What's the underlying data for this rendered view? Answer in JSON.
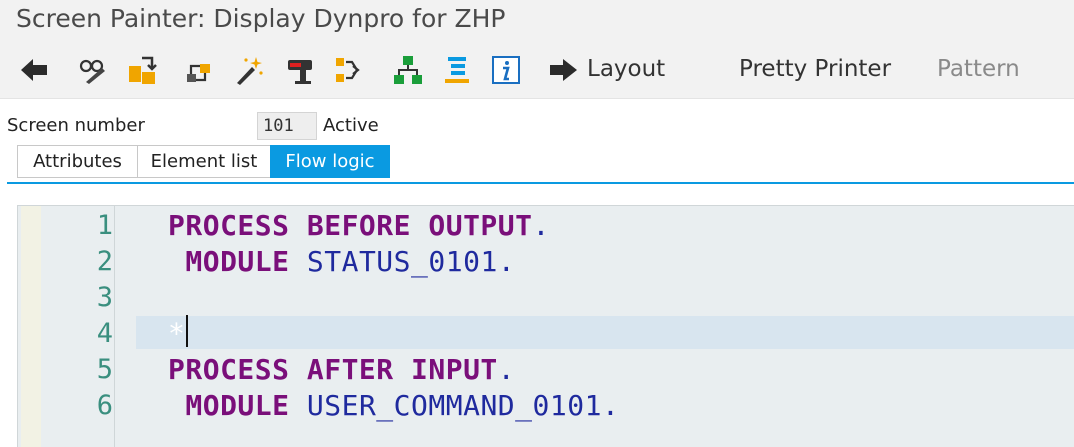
{
  "window": {
    "title": "Screen Painter: Display Dynpro for ZHP"
  },
  "toolbar": {
    "icons": [
      "back-arrow-icon",
      "display-change-icon",
      "activate-icon",
      "check-icon",
      "magic-wand-icon",
      "stamp-icon",
      "where-used-icon",
      "hierarchy-icon",
      "list-icon",
      "info-icon"
    ],
    "layout_label": "Layout",
    "pretty_printer_label": "Pretty Printer",
    "pattern_label": "Pattern"
  },
  "screen": {
    "number_label": "Screen number",
    "number_value": "101",
    "status": "Active"
  },
  "tabs": [
    {
      "label": "Attributes",
      "active": false
    },
    {
      "label": "Element list",
      "active": false
    },
    {
      "label": "Flow logic",
      "active": true
    }
  ],
  "editor": {
    "lines": [
      {
        "no": "1",
        "tokens": [
          {
            "t": "PROCESS BEFORE OUTPUT",
            "c": "kw"
          },
          {
            "t": ".",
            "c": "pd"
          }
        ]
      },
      {
        "no": "2",
        "tokens": [
          {
            "t": " MODULE",
            "c": "kw"
          },
          {
            "t": " STATUS_0101",
            "c": "id"
          },
          {
            "t": ".",
            "c": "pd"
          }
        ]
      },
      {
        "no": "3",
        "tokens": []
      },
      {
        "no": "4",
        "tokens": [
          {
            "t": "*",
            "c": "cmt"
          }
        ]
      },
      {
        "no": "5",
        "tokens": [
          {
            "t": "PROCESS AFTER INPUT",
            "c": "kw"
          },
          {
            "t": ".",
            "c": "pd"
          }
        ]
      },
      {
        "no": "6",
        "tokens": [
          {
            "t": " MODULE",
            "c": "kw"
          },
          {
            "t": " USER_COMMAND_0101",
            "c": "id"
          },
          {
            "t": ".",
            "c": "pd"
          }
        ]
      }
    ],
    "colors": {
      "keyword": "#7a0f7a",
      "identifier": "#1f2a9e",
      "line_number": "#3a8f7f",
      "active_tab": "#0a9ae1"
    }
  }
}
